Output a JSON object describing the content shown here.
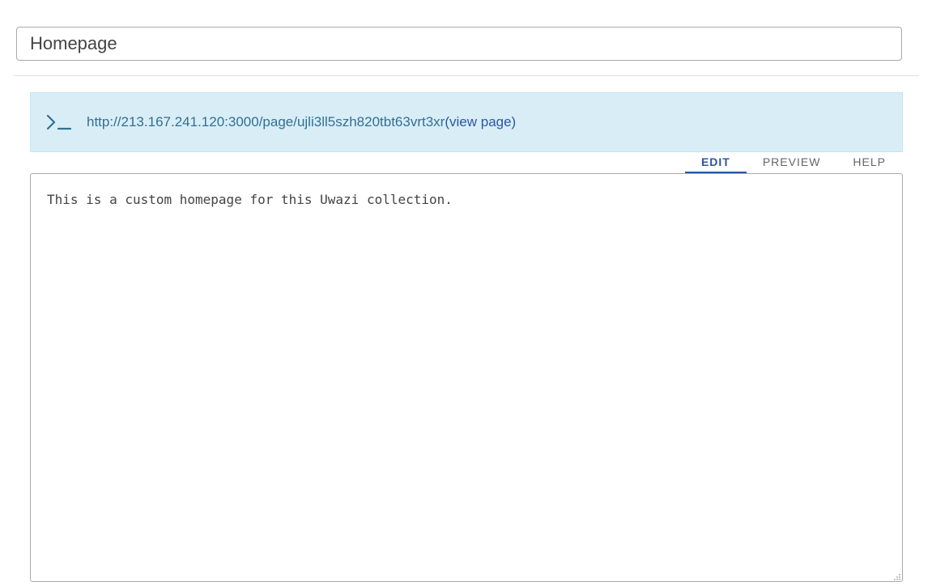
{
  "page_title": {
    "value": "Homepage"
  },
  "url_banner": {
    "icon": "terminal-icon",
    "url": "http://213.167.241.120:3000/page/ujli3ll5szh820tbt63vrt3xr",
    "view_link_label": "(view page)"
  },
  "editor_tabs": {
    "tabs": [
      {
        "label": "EDIT",
        "active": true
      },
      {
        "label": "PREVIEW",
        "active": false
      },
      {
        "label": "HELP",
        "active": false
      }
    ]
  },
  "editor": {
    "content": "This is a custom homepage for this Uwazi collection."
  },
  "colors": {
    "accent": "#2b56a3",
    "info_bg": "#d9edf7",
    "info_text": "#31708f"
  }
}
